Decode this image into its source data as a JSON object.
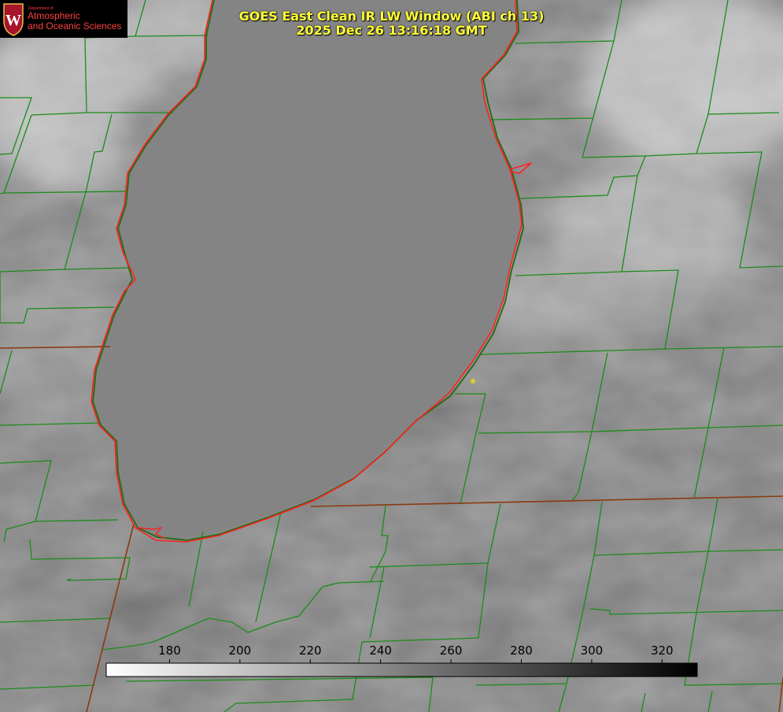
{
  "title": {
    "line1": "GOES East Clean IR LW Window (ABI ch 13)",
    "line2": "2025 Dec 26 13:16:18 GMT"
  },
  "logo": {
    "department": "Department of",
    "line1": "Atmospheric",
    "line2": "and Oceanic Sciences",
    "seal_letter": "W",
    "icon": "university-seal-icon"
  },
  "colorbar": {
    "vmin": 162,
    "vmax": 330,
    "ticks": [
      180,
      200,
      220,
      240,
      260,
      280,
      300,
      320
    ],
    "tick_labels": [
      "180",
      "200",
      "220",
      "240",
      "260",
      "280",
      "300",
      "320"
    ],
    "from_color": "#ffffff",
    "to_color": "#000000"
  },
  "colors": {
    "title_text": "#ffff33",
    "county_lines": "#1a8c1a",
    "state_lines": "#8a3a10",
    "lake_outline": "#ff2020",
    "logo_background": "#000000",
    "logo_text": "#ff4040",
    "marker": "#e0d020"
  }
}
